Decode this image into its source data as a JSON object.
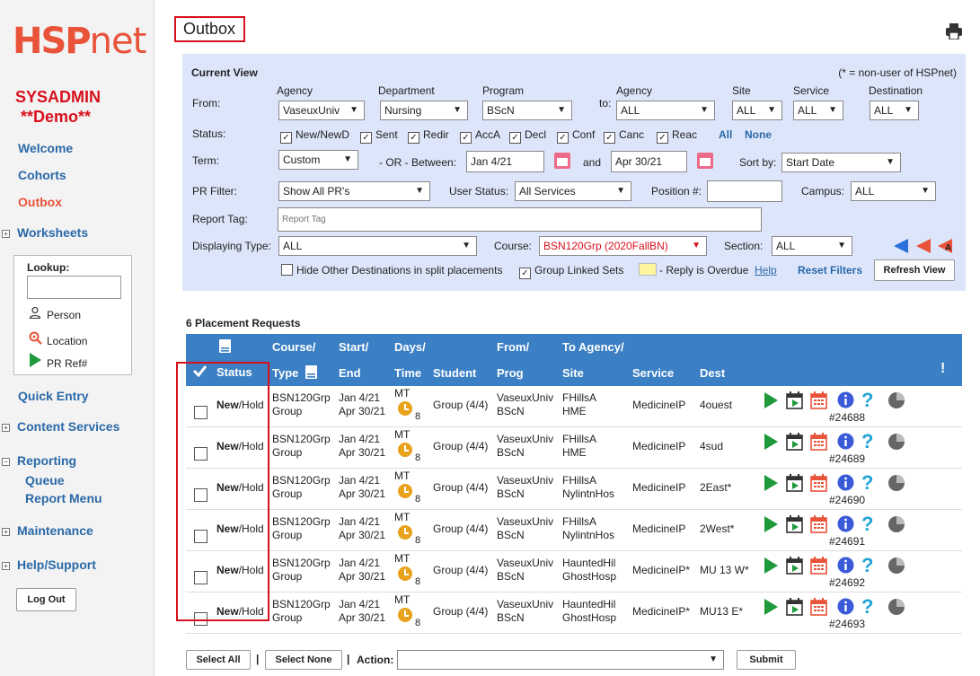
{
  "logo": {
    "hsp": "HSP",
    "net": "net"
  },
  "sidebar": {
    "user": "SYSADMIN",
    "env": "**Demo**",
    "nav": [
      {
        "label": "Welcome"
      },
      {
        "label": "Cohorts"
      },
      {
        "label": "Outbox"
      }
    ],
    "worksheets": "Worksheets",
    "lookup": {
      "label": "Lookup:",
      "person": "Person",
      "location": "Location",
      "prref": "PR Ref#"
    },
    "quick_entry": "Quick Entry",
    "content_services": "Content Services",
    "reporting": "Reporting",
    "queue": "Queue",
    "report_menu": "Report Menu",
    "maintenance": "Maintenance",
    "help_support": "Help/Support",
    "logout": "Log Out"
  },
  "page": {
    "title": "Outbox"
  },
  "filters": {
    "current_view": "Current View",
    "nonuser_note": "(* = non-user of HSPnet)",
    "from_label": "From:",
    "to_label": "to:",
    "agency_h": "Agency",
    "department_h": "Department",
    "program_h": "Program",
    "agency2_h": "Agency",
    "site_h": "Site",
    "service_h": "Service",
    "destination_h": "Destination",
    "from_agency": "VaseuxUniv",
    "from_department": "Nursing",
    "from_program": "BScN",
    "to_agency": "ALL",
    "site": "ALL",
    "service": "ALL",
    "destination": "ALL",
    "status_label": "Status:",
    "statuses": [
      "New/NewD",
      "Sent",
      "Redir",
      "AccA",
      "Decl",
      "Conf",
      "Canc",
      "Reac"
    ],
    "all_link": "All",
    "none_link": "None",
    "term_label": "Term:",
    "term": "Custom",
    "or_between": "- OR -  Between:",
    "start_date": "Jan 4/21",
    "and_label": "and",
    "end_date": "Apr 30/21",
    "sortby_label": "Sort by:",
    "sortby": "Start Date",
    "prfilter_label": "PR Filter:",
    "prfilter": "Show All PR's",
    "userstatus_label": "User Status:",
    "userstatus": "All Services",
    "position_label": "Position #:",
    "campus_label": "Campus:",
    "campus": "ALL",
    "reporttag_label": "Report Tag:",
    "reporttag_placeholder": "Report Tag",
    "displaying_label": "Displaying Type:",
    "displaying": "ALL",
    "course_label": "Course:",
    "course": "BSN120Grp (2020FallBN)",
    "section_label": "Section:",
    "section": "ALL",
    "hide_other": "Hide Other Destinations in split placements",
    "group_linked": "Group Linked Sets",
    "reply_overdue": "- Reply is Overdue",
    "help": "Help",
    "reset": "Reset Filters",
    "refresh": "Refresh View",
    "colors": {
      "overdue": "#fff59e",
      "panel": "#dde5fa",
      "header": "#3b7fc4"
    }
  },
  "results": {
    "title": "6 Placement Requests",
    "headers": {
      "status": "Status",
      "course": "Course/",
      "type": "Type",
      "start": "Start/",
      "end": "End",
      "days": "Days/",
      "time": "Time",
      "student": "Student",
      "from": "From/",
      "prog": "Prog",
      "to_agency": "To Agency/",
      "site": "Site",
      "service": "Service",
      "dest": "Dest",
      "alert": "!"
    },
    "rows": [
      {
        "status_b": "New",
        "status_r": "/Hold",
        "course": "BSN120Grp",
        "type": "Group",
        "start": "Jan 4/21",
        "end": "Apr 30/21",
        "days": "MT",
        "time": "8",
        "student": "Group (4/4)",
        "from": "VaseuxUniv",
        "prog": "BScN",
        "to": "FHillsA",
        "site": "HME",
        "service": "MedicineIP",
        "dest": "4ouest",
        "ref": "#24688"
      },
      {
        "status_b": "New",
        "status_r": "/Hold",
        "course": "BSN120Grp",
        "type": "Group",
        "start": "Jan 4/21",
        "end": "Apr 30/21",
        "days": "MT",
        "time": "8",
        "student": "Group (4/4)",
        "from": "VaseuxUniv",
        "prog": "BScN",
        "to": "FHillsA",
        "site": "HME",
        "service": "MedicineIP",
        "dest": "4sud",
        "ref": "#24689"
      },
      {
        "status_b": "New",
        "status_r": "/Hold",
        "course": "BSN120Grp",
        "type": "Group",
        "start": "Jan 4/21",
        "end": "Apr 30/21",
        "days": "MT",
        "time": "8",
        "student": "Group (4/4)",
        "from": "VaseuxUniv",
        "prog": "BScN",
        "to": "FHillsA",
        "site": "NylintnHos",
        "service": "MedicineIP",
        "dest": "2East*",
        "ref": "#24690"
      },
      {
        "status_b": "New",
        "status_r": "/Hold",
        "course": "BSN120Grp",
        "type": "Group",
        "start": "Jan 4/21",
        "end": "Apr 30/21",
        "days": "MT",
        "time": "8",
        "student": "Group (4/4)",
        "from": "VaseuxUniv",
        "prog": "BScN",
        "to": "FHillsA",
        "site": "NylintnHos",
        "service": "MedicineIP",
        "dest": "2West*",
        "ref": "#24691"
      },
      {
        "status_b": "New",
        "status_r": "/Hold",
        "course": "BSN120Grp",
        "type": "Group",
        "start": "Jan 4/21",
        "end": "Apr 30/21",
        "days": "MT",
        "time": "8",
        "student": "Group (4/4)",
        "from": "VaseuxUniv",
        "prog": "BScN",
        "to": "HauntedHil",
        "site": "GhostHosp",
        "service": "MedicineIP*",
        "dest": "MU 13 W*",
        "ref": "#24692"
      },
      {
        "status_b": "New",
        "status_r": "/Hold",
        "course": "BSN120Grp",
        "type": "Group",
        "start": "Jan 4/21",
        "end": "Apr 30/21",
        "days": "MT",
        "time": "8",
        "student": "Group (4/4)",
        "from": "VaseuxUniv",
        "prog": "BScN",
        "to": "HauntedHil",
        "site": "GhostHosp",
        "service": "MedicineIP*",
        "dest": "MU13 E*",
        "ref": "#24693"
      }
    ]
  },
  "bottom": {
    "select_all": "Select All",
    "sep": "|",
    "select_none": "Select None",
    "action_label": "Action:",
    "action_value": "",
    "submit": "Submit"
  }
}
